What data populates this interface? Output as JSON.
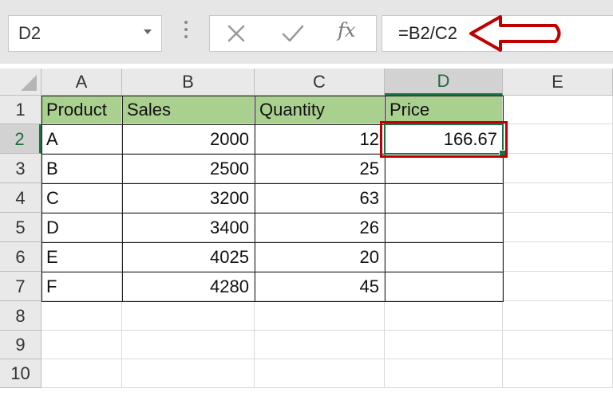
{
  "name_box": {
    "value": "D2"
  },
  "formula_bar": {
    "value": "=B2/C2",
    "cancel_icon": "x-icon",
    "enter_icon": "check-icon",
    "fx_label": "fx"
  },
  "columns": [
    "A",
    "B",
    "C",
    "D",
    "E"
  ],
  "rows": [
    "1",
    "2",
    "3",
    "4",
    "5",
    "6",
    "7",
    "8",
    "9",
    "10"
  ],
  "table": {
    "header": [
      "Product",
      "Sales",
      "Quantity",
      "Price"
    ],
    "data": [
      [
        "A",
        "2000",
        "12",
        "166.67"
      ],
      [
        "B",
        "2500",
        "25",
        ""
      ],
      [
        "C",
        "3200",
        "63",
        ""
      ],
      [
        "D",
        "3400",
        "26",
        ""
      ],
      [
        "E",
        "4025",
        "20",
        ""
      ],
      [
        "F",
        "4280",
        "45",
        ""
      ]
    ]
  },
  "selected_cell": "D2",
  "colors": {
    "header_fill": "#a9d08e",
    "selection": "#1e7145",
    "annotation": "#c00000"
  }
}
